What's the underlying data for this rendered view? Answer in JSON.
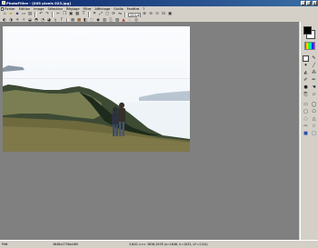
{
  "window": {
    "title": "PhotoFiltre - [005 pixels 023.jpg]",
    "buttons": {
      "minimize": "_",
      "maximize": "□",
      "close": "×"
    }
  },
  "menubar": [
    "Fichier",
    "Edition",
    "Image",
    "Sélection",
    "Réglage",
    "Filtre",
    "Affichage",
    "Outils",
    "Fenêtre",
    "?"
  ],
  "toolbar1": {
    "zoom_value": "25%",
    "icons": [
      "new-icon",
      "open-icon",
      "save-icon",
      "print-icon",
      "scan-icon",
      "undo-icon",
      "redo-icon",
      "cut-icon",
      "copy-icon",
      "paste-icon",
      "paste-new-icon",
      "text-icon",
      "crop-icon",
      "resize-icon",
      "canvas-icon",
      "rotate-icon",
      "flip-icon",
      "zoom-in-icon",
      "zoom-out-icon",
      "actual-size-icon",
      "fit-window-icon",
      "fullscreen-icon"
    ]
  },
  "toolbar2": {
    "icons": [
      "auto-level-icon",
      "auto-contrast-icon",
      "brightness-down-icon",
      "brightness-up-icon",
      "contrast-down-icon",
      "contrast-up-icon",
      "saturation-down-icon",
      "saturation-up-icon",
      "gamma-down-icon",
      "gamma-up-icon",
      "grayscale-icon",
      "sepia-icon",
      "invert-icon",
      "blur-icon",
      "sharpen-icon",
      "emboss-icon",
      "noise-icon",
      "relief-icon",
      "color-balance-icon",
      "dust-icon",
      "vignette-icon"
    ]
  },
  "palette": {
    "foreground_color": "#000000",
    "background_color": "#ffffff",
    "tools": [
      "select-icon",
      "color-picker-icon",
      "magic-wand-icon",
      "line-icon",
      "fill-icon",
      "spray-icon",
      "brush-icon",
      "advanced-brush-icon",
      "blur-tool-icon",
      "smudge-icon",
      "clone-icon",
      "eraser-icon",
      "rectangle-shape-icon",
      "ellipse-shape-icon",
      "rounded-shape-icon",
      "polygon-shape-icon",
      "lasso-icon",
      "triangle-icon",
      "arrow-shape-icon",
      "star-shape-icon",
      "fill-shape-icon",
      "outline-shape-icon"
    ]
  },
  "statusbar": {
    "state": "Prêt",
    "dimensions": "3648x2736x16M",
    "info": "3,620 >>> 3636,2878 (x=1646, h=1032, LF=1124)"
  }
}
